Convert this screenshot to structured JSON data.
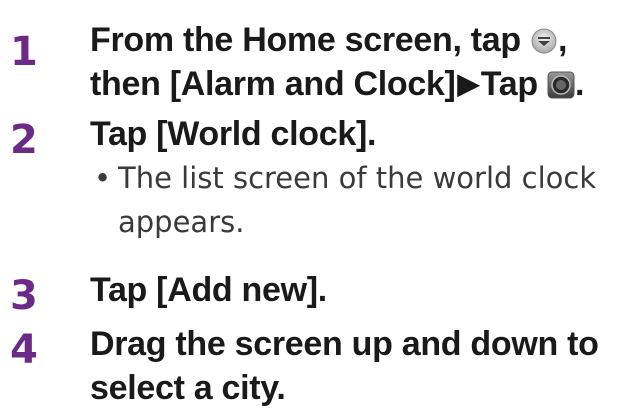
{
  "steps": [
    {
      "number": "1",
      "line1_a": "From the Home screen, tap ",
      "line1_b": ",",
      "line2_a": "then [Alarm and Clock]",
      "arrow": "▶",
      "line2_b": "Tap ",
      "line2_c": ".",
      "icons": [
        "menu-icon",
        "clock-app-icon"
      ]
    },
    {
      "number": "2",
      "text": "Tap [World clock].",
      "bullet_mark": "•",
      "bullet_line1": "The list screen of the world clock",
      "bullet_line2": "appears."
    },
    {
      "number": "3",
      "text": "Tap [Add new]."
    },
    {
      "number": "4",
      "line1": "Drag the screen up and down to",
      "line2": "select a city."
    }
  ],
  "colors": {
    "step_number": "#6b2a86",
    "text": "#1a1a1a"
  }
}
